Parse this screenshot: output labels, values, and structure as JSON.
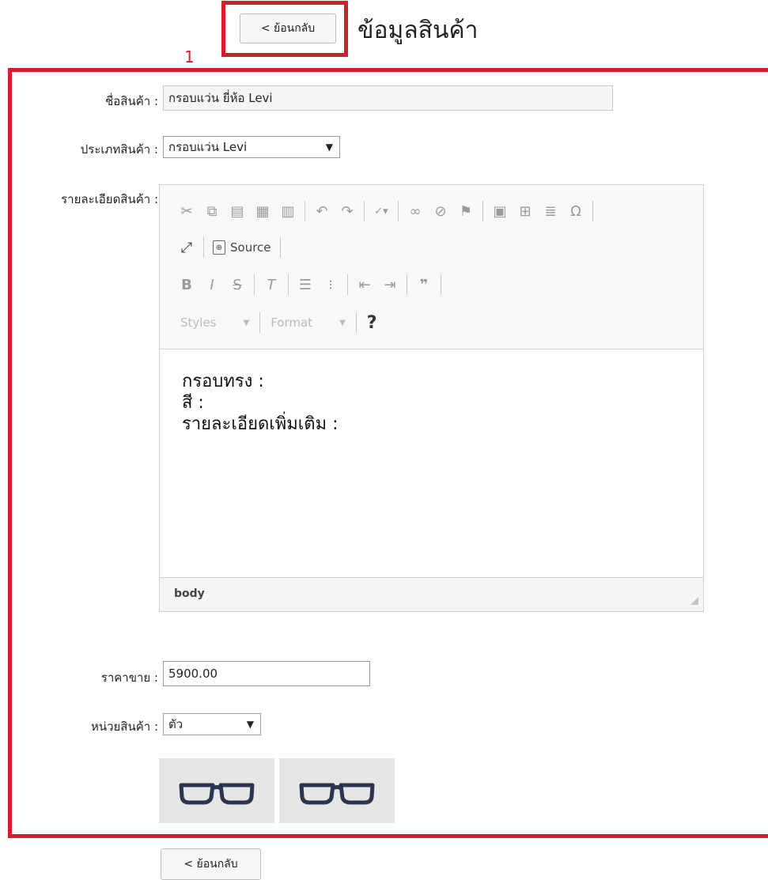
{
  "header": {
    "back_label": "< ย้อนกลับ",
    "title": "ข้อมูลสินค้า",
    "annotation_marker": "1"
  },
  "form": {
    "name_label": "ชื่อสินค้า :",
    "name_value": "กรอบแว่น ยี่ห้อ Levi",
    "category_label": "ประเภทสินค้า :",
    "category_value": "กรอบแว่น Levi",
    "details_label": "รายละเอียดสินค้า :",
    "price_label": "ราคาขาย :",
    "price_value": "5900.00",
    "unit_label": "หน่วยสินค้า :",
    "unit_value": "ตัว"
  },
  "editor": {
    "source_label": "Source",
    "styles_label": "Styles",
    "format_label": "Format",
    "help_label": "?",
    "content_lines": [
      "กรอบทรง :",
      "สี :",
      "รายละเอียดเพิ่มเติม :"
    ],
    "status_path": "body"
  },
  "images": {
    "count": 2
  },
  "footer": {
    "back_label": "< ย้อนกลับ"
  },
  "colors": {
    "highlight": "#d0202f",
    "frame": "#2a3550"
  }
}
